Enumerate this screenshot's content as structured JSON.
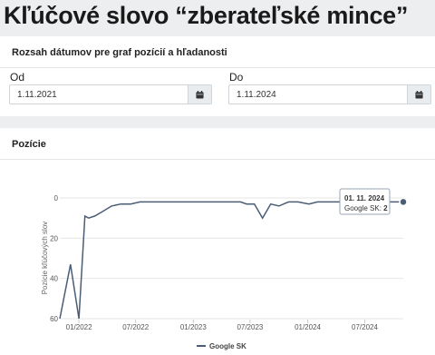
{
  "page": {
    "title": "Kľúčové slovo “zberateľské mince”"
  },
  "date_range": {
    "header": "Rozsah dátumov pre graf pozícií a hľadanosti",
    "from_label": "Od",
    "from_value": "1.11.2021",
    "to_label": "Do",
    "to_value": "1.11.2024"
  },
  "positions": {
    "header": "Pozície"
  },
  "tooltip": {
    "date": "01. 11. 2024",
    "series": "Google SK",
    "value": "2"
  },
  "icons": {
    "calendar": "calendar-icon"
  },
  "colors": {
    "line": "#4a5d75",
    "grid": "#e6e6e6"
  },
  "chart_data": {
    "type": "line",
    "ylabel": "Pozície kľúčových slov",
    "xlabel": "",
    "ylim": [
      60,
      0
    ],
    "y_reversed": true,
    "y_ticks": [
      "0",
      "20",
      "40",
      "60"
    ],
    "x_ticks": [
      "01/2022",
      "07/2022",
      "01/2023",
      "07/2023",
      "01/2024",
      "07/2024"
    ],
    "legend": "bottom-center",
    "series": [
      {
        "name": "Google SK",
        "x": [
          "2021-11-01",
          "2021-12-05",
          "2022-01-01",
          "2022-01-20",
          "2022-02-01",
          "2022-02-20",
          "2022-03-15",
          "2022-04-15",
          "2022-05-15",
          "2022-06-15",
          "2022-07-15",
          "2022-08-15",
          "2022-09-01",
          "2022-12-01",
          "2023-03-01",
          "2023-06-01",
          "2023-06-20",
          "2023-07-15",
          "2023-08-10",
          "2023-09-05",
          "2023-10-01",
          "2023-11-01",
          "2023-12-01",
          "2024-01-05",
          "2024-02-01",
          "2024-03-01",
          "2024-04-01",
          "2024-05-01",
          "2024-06-01",
          "2024-06-20",
          "2024-07-15",
          "2024-08-15",
          "2024-09-15",
          "2024-10-15",
          "2024-11-01"
        ],
        "values": [
          60,
          33,
          60,
          9,
          10,
          9,
          7,
          4,
          3,
          3,
          2,
          2,
          2,
          2,
          2,
          2,
          3,
          3,
          10,
          3,
          4,
          2,
          2,
          3,
          2,
          2,
          2,
          2,
          3,
          3,
          2,
          2,
          2,
          2,
          2
        ]
      }
    ]
  }
}
